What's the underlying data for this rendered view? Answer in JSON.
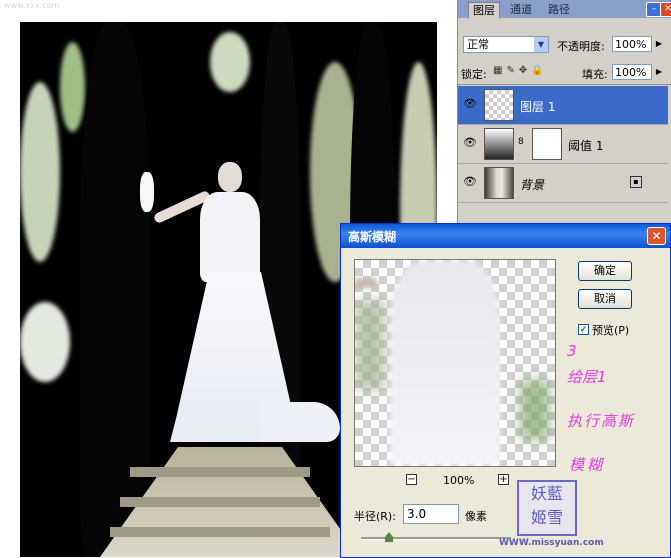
{
  "canvas": {
    "watermark_top": "www.xxx.com",
    "site_watermark": "WWW.missyuan.com"
  },
  "layers_panel": {
    "tabs": [
      "图层",
      "通道",
      "路径"
    ],
    "blend_mode": "正常",
    "opacity_label": "不透明度:",
    "opacity_value": "100%",
    "lock_label": "锁定:",
    "fill_label": "填充:",
    "fill_value": "100%",
    "layers": [
      {
        "name": "图层 1",
        "selected": true
      },
      {
        "name": "阈值 1",
        "selected": false
      },
      {
        "name": "背景",
        "selected": false,
        "locked": true
      }
    ]
  },
  "dialog": {
    "title": "高斯模糊",
    "ok_label": "确定",
    "cancel_label": "取消",
    "preview_label": "预览(P)",
    "preview_checked": true,
    "zoom_value": "100%",
    "radius_label": "半径(R):",
    "radius_value": "3.0",
    "unit_label": "像素",
    "slider_level": 0.2,
    "annotation_lines": [
      "3",
      "给层1",
      "执行高斯",
      "模糊"
    ],
    "stamp_lines": [
      "妖藍",
      "姬雪"
    ]
  },
  "colors": {
    "title_bar": "#0a5ad8",
    "selected_layer": "#3a6bc9",
    "annotation": "#e040e0"
  },
  "icons": [
    "eye-icon",
    "lock-icon",
    "close-icon",
    "minimize-icon",
    "zoom-in-icon",
    "zoom-out-icon",
    "checkmark-icon",
    "chevron-down-icon"
  ]
}
